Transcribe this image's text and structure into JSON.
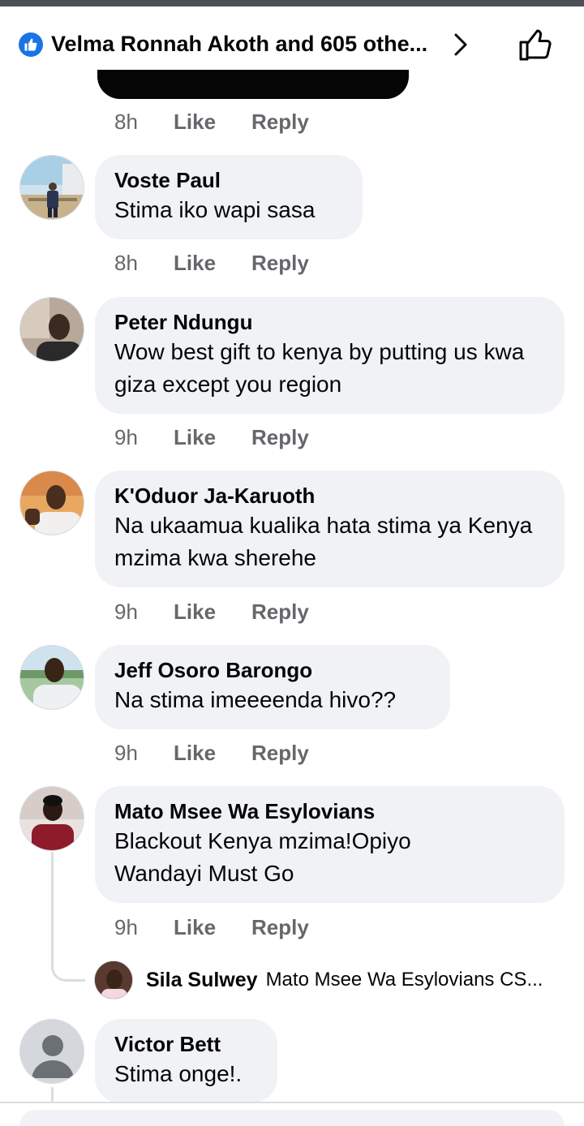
{
  "header": {
    "reactors_label": "Velma Ronnah Akoth and 605 othe...",
    "icons": [
      "like-badge-icon",
      "chevron-right-icon",
      "thumbs-up-outline-icon"
    ]
  },
  "action_labels": {
    "like": "Like",
    "reply": "Reply"
  },
  "top_actions": {
    "time": "8h"
  },
  "comments": [
    {
      "name": "Voste Paul",
      "text": "Stima iko wapi sasa",
      "time": "8h"
    },
    {
      "name": "Peter Ndungu",
      "text": "Wow best gift to kenya by putting us kwa giza except you region",
      "time": "9h"
    },
    {
      "name": "K'Oduor Ja-Karuoth",
      "text": "Na ukaamua kualika hata stima ya Kenya mzima kwa sherehe",
      "time": "9h"
    },
    {
      "name": "Jeff Osoro Barongo",
      "text": "Na stima imeeeenda hivo??",
      "time": "9h"
    },
    {
      "name": "Mato Msee Wa Esylovians",
      "text": "Blackout Kenya mzima!Opiyo Wandayi Must Go",
      "time": "9h"
    },
    {
      "name": "Victor Bett",
      "text": "Stima onge!."
    }
  ],
  "reply_preview": {
    "name": "Sila Sulwey",
    "text": "Mato Msee Wa Esylovians  CS..."
  },
  "colors": {
    "bubble": "#f0f2f5",
    "meta_text": "#65676b",
    "facebook_blue": "#1b74e4"
  }
}
